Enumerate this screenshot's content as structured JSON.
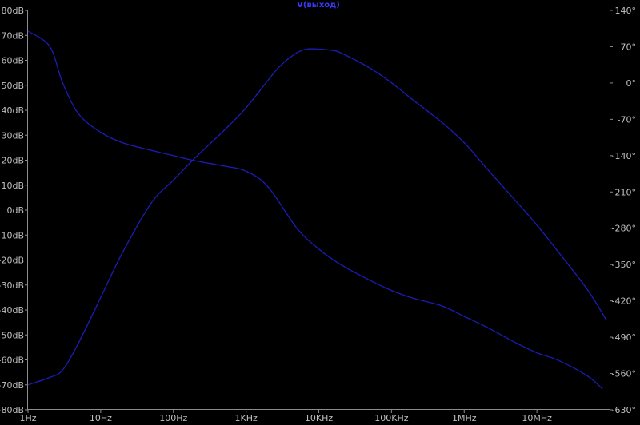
{
  "chart_data": {
    "type": "line",
    "title": "V(выход)",
    "x_scale": "log",
    "xlim": [
      1,
      100000000
    ],
    "x_ticks": [
      "1Hz",
      "10Hz",
      "100Hz",
      "1KHz",
      "10KHz",
      "100KHz",
      "1MHz",
      "10MHz"
    ],
    "y_left": {
      "unit": "dB",
      "ylim": [
        -80,
        80
      ],
      "ticks": [
        "80dB",
        "70dB",
        "60dB",
        "50dB",
        "40dB",
        "30dB",
        "20dB",
        "10dB",
        "0dB",
        "-10dB",
        "-20dB",
        "-30dB",
        "-40dB",
        "-50dB",
        "-60dB",
        "-70dB",
        "-80dB"
      ]
    },
    "y_right": {
      "unit": "°",
      "ylim": [
        -630,
        140
      ],
      "ticks": [
        "140°",
        "70°",
        "0°",
        "-70°",
        "-140°",
        "-210°",
        "-280°",
        "-350°",
        "-420°",
        "-490°",
        "-560°",
        "-630°"
      ]
    },
    "grid": false,
    "series": [
      {
        "axis": "left",
        "color": "#1c1cb8",
        "x": [
          1,
          2,
          3,
          5,
          10,
          20,
          50,
          100,
          200,
          500,
          1000,
          2000,
          3000,
          5000,
          7000,
          10000,
          15000,
          20000,
          50000,
          100000,
          200000,
          500000,
          1000000,
          2000000,
          5000000,
          10000000,
          20000000,
          50000000,
          90000000
        ],
        "values": [
          -70,
          -67,
          -64,
          -53,
          -35,
          -17,
          3,
          12,
          21,
          32,
          41,
          52,
          58,
          63,
          64.5,
          64.5,
          64,
          63,
          57,
          51,
          44,
          35,
          27,
          17,
          4,
          -6,
          -17,
          -32,
          -44
        ]
      },
      {
        "axis": "right",
        "color": "#1c1cb8",
        "x": [
          1,
          2,
          3,
          5,
          10,
          20,
          50,
          100,
          200,
          500,
          1000,
          2000,
          5000,
          10000,
          20000,
          50000,
          100000,
          200000,
          500000,
          1000000,
          2000000,
          5000000,
          10000000,
          20000000,
          50000000,
          80000000
        ],
        "values": [
          100,
          70,
          0,
          -60,
          -95,
          -115,
          -130,
          -140,
          -150,
          -160,
          -170,
          -200,
          -280,
          -320,
          -350,
          -380,
          -400,
          -415,
          -430,
          -450,
          -470,
          -500,
          -520,
          -535,
          -565,
          -590
        ]
      }
    ]
  }
}
